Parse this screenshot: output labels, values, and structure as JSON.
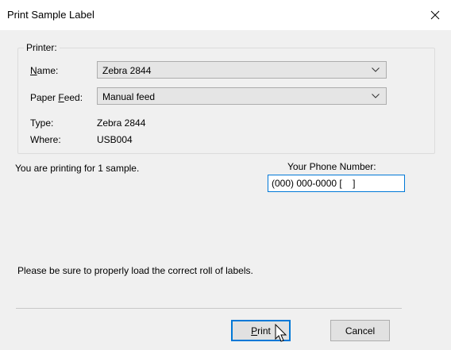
{
  "window": {
    "title": "Print Sample Label",
    "close_icon": "close-icon"
  },
  "printer": {
    "group_label": "Printer:",
    "name_label_accel": "N",
    "name_label_rest": "ame:",
    "name_value": "Zebra 2844",
    "paper_feed_label_pre": "Paper ",
    "paper_feed_label_accel": "F",
    "paper_feed_label_rest": "eed:",
    "paper_feed_value": "Manual feed",
    "type_label": "Type:",
    "type_value": "Zebra 2844",
    "where_label": "Where:",
    "where_value": "USB004"
  },
  "info": {
    "sample_text": "You are printing for 1 sample.",
    "phone_label": "Your Phone Number:",
    "phone_value": "(000) 000-0000 [    ]",
    "load_text": "Please be sure to properly load the correct roll of labels."
  },
  "buttons": {
    "print_accel": "P",
    "print_rest": "rint",
    "cancel": "Cancel"
  },
  "colors": {
    "accent": "#0078d7",
    "background": "#f0f0f0"
  }
}
